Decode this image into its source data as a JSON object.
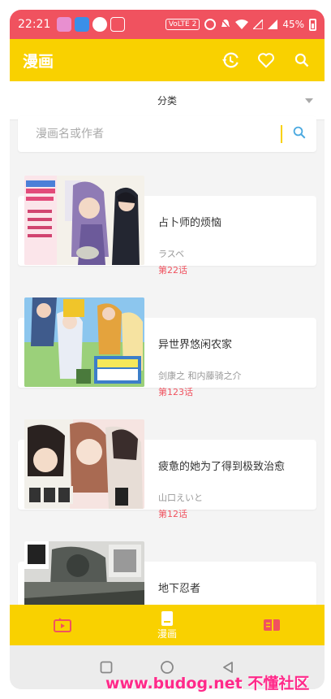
{
  "status_bar": {
    "time": "22:21",
    "network": "VoLTE 2",
    "battery": "45%"
  },
  "app_bar": {
    "title": "漫画",
    "icons": [
      "history-icon",
      "heart-icon",
      "search-icon"
    ]
  },
  "category": {
    "label": "分类"
  },
  "search": {
    "placeholder": "漫画名或作者"
  },
  "comics": [
    {
      "title": "占卜师的烦恼",
      "author": "ラスベ",
      "chapter": "第22话"
    },
    {
      "title": "异世界悠闲农家",
      "author": "剑康之 和内藤骑之介",
      "chapter": "第123话"
    },
    {
      "title": "疲惫的她为了得到极致治愈",
      "author": "山口えいと",
      "chapter": "第12话"
    },
    {
      "title": "地下忍者",
      "author": "",
      "chapter": ""
    }
  ],
  "bottom_nav": {
    "tabs": [
      {
        "label": "",
        "icon": "tv-icon"
      },
      {
        "label": "漫画",
        "icon": "book-icon"
      },
      {
        "label": "",
        "icon": "novel-icon"
      }
    ]
  },
  "watermark": "www.budog.net 不懂社区",
  "colors": {
    "accent": "#f9d100",
    "status_bar": "#f0525f",
    "chapter": "#f0525f"
  }
}
